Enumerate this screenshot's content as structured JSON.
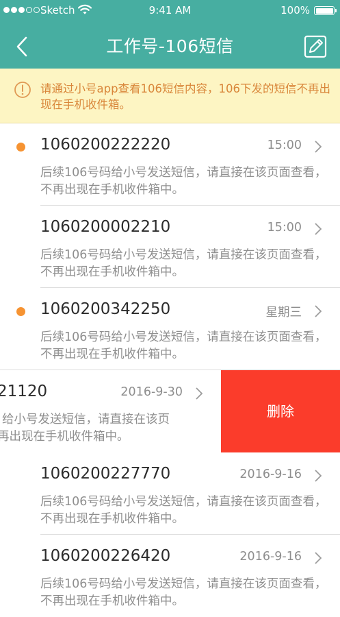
{
  "status_bar": {
    "carrier": "Sketch",
    "time": "9:41 AM",
    "battery": "100%"
  },
  "nav": {
    "title": "工作号-106短信",
    "back_icon": "chevron-left-icon",
    "compose_icon": "compose-icon"
  },
  "notice": {
    "text": "请通过小号app查看106短信内容，106下发的短信不再出现在手机收件箱。",
    "icon": "info-circle-icon"
  },
  "colors": {
    "header_bg": "#47aea1",
    "notice_bg": "#fdf5c3",
    "notice_text": "#d9863a",
    "unread_dot": "#f69332",
    "delete_bg": "#fb3c2b"
  },
  "messages": [
    {
      "number": "1060200222220",
      "time": "15:00",
      "preview": "后续106号码给小号发送短信，请直接在该页面查看，不再出现在手机收件箱中。",
      "unread": true
    },
    {
      "number": "1060200002210",
      "time": "15:00",
      "preview": "后续106号码给小号发送短信，请直接在该页面查看，不再出现在手机收件箱中。",
      "unread": false
    },
    {
      "number": "1060200342250",
      "time": "星期三",
      "preview": "后续106号码给小号发送短信，请直接在该页面查看，不再出现在手机收件箱中。",
      "unread": true
    },
    {
      "number": "21120",
      "time": "2016-9-30",
      "preview": "给小号发送短信，请直接在该页",
      "preview_line2": "再出现在手机收件箱中。",
      "unread": false,
      "swiped": true,
      "delete_label": "删除"
    },
    {
      "number": "1060200227770",
      "time": "2016-9-16",
      "preview": "后续106号码给小号发送短信，请直接在该页面查看，不再出现在手机收件箱中。",
      "unread": false
    },
    {
      "number": "1060200226420",
      "time": "2016-9-16",
      "preview": "后续106号码给小号发送短信，请直接在该页面查看，不再出现在手机收件箱中。",
      "unread": false
    }
  ]
}
